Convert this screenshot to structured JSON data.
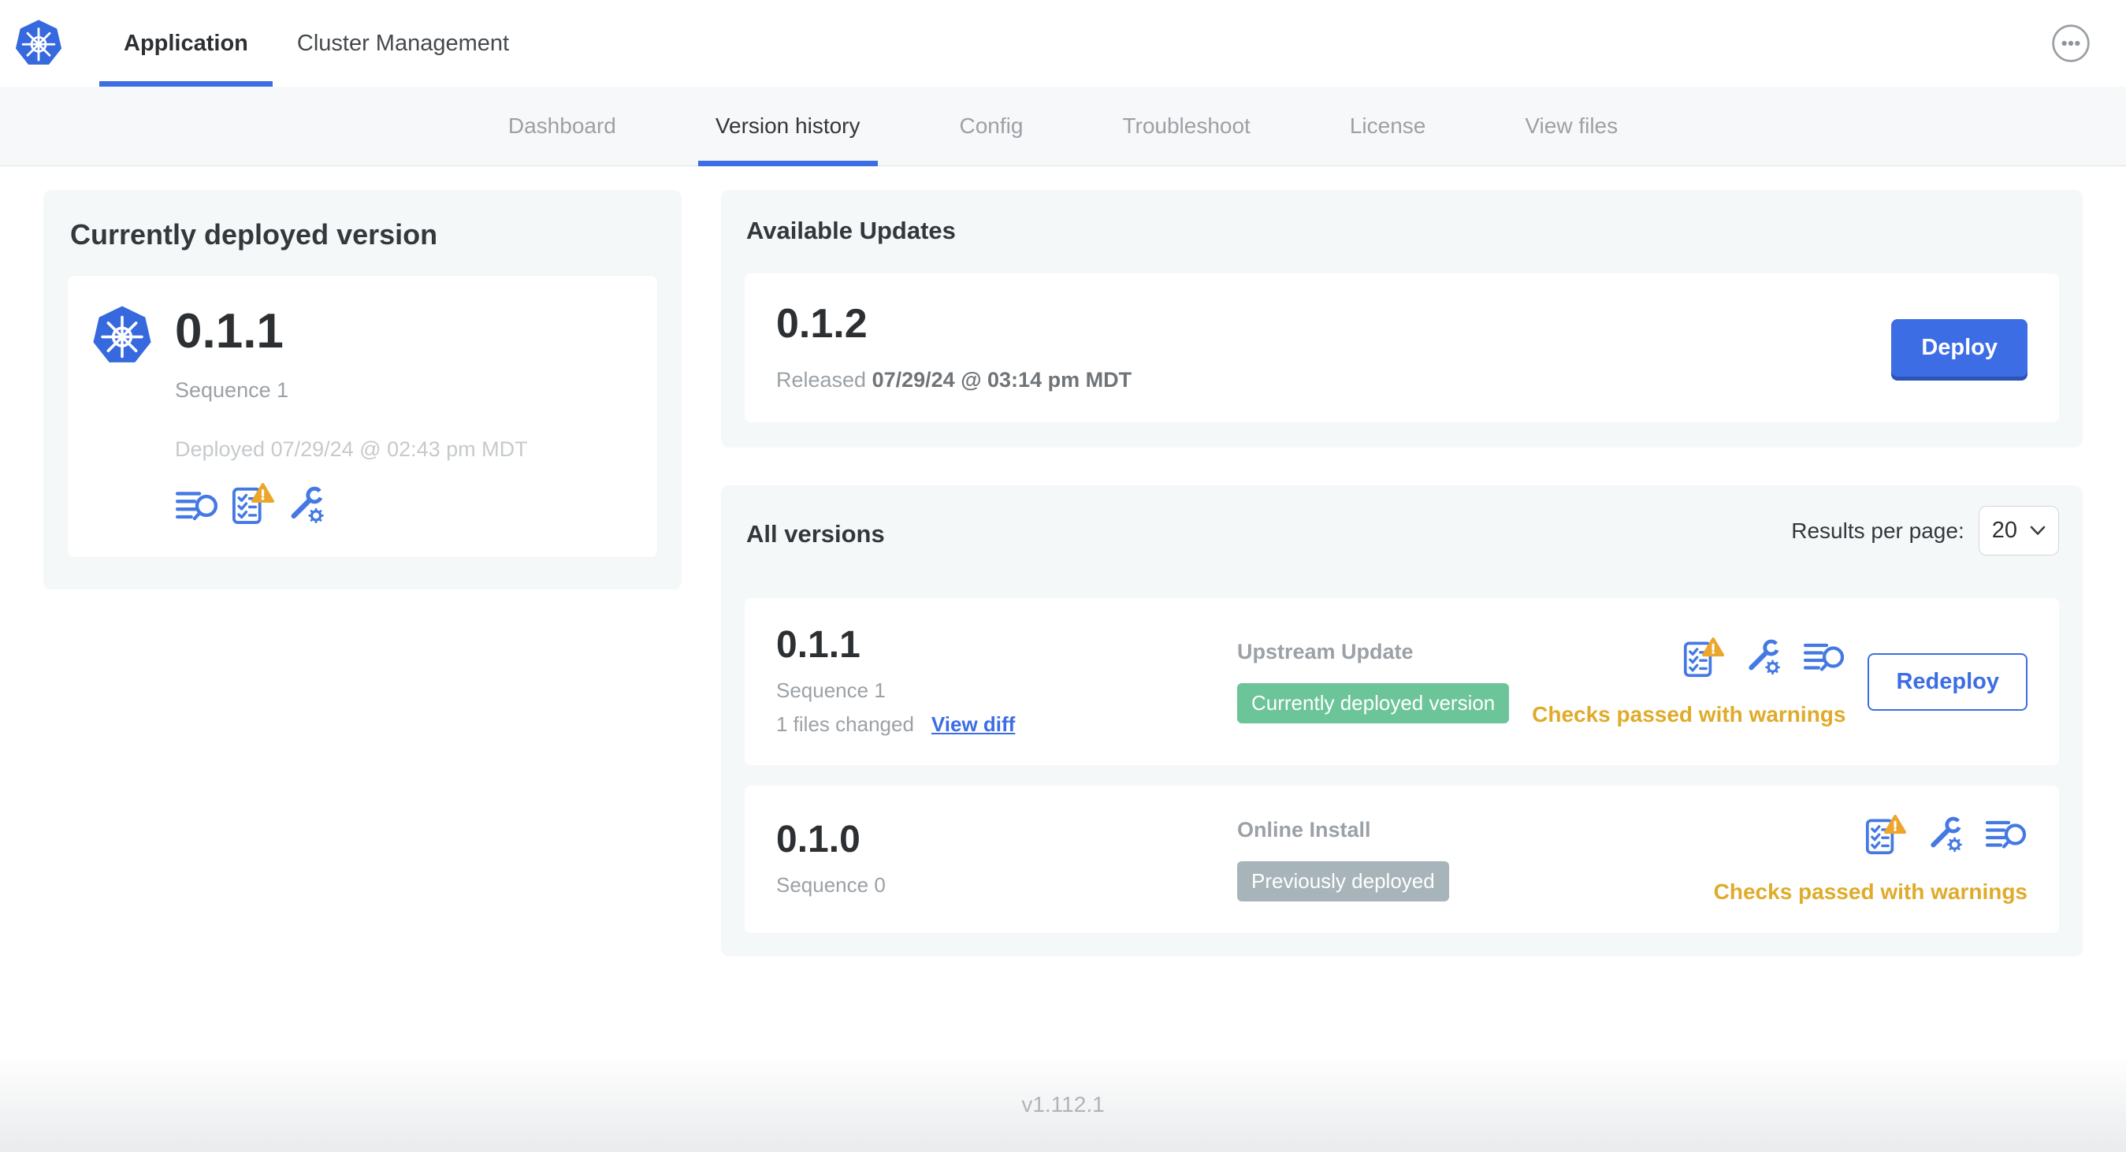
{
  "topbar": {
    "tabs": [
      {
        "label": "Application",
        "active": true
      },
      {
        "label": "Cluster Management",
        "active": false
      }
    ],
    "menu_icon": "ellipsis-icon",
    "logo_icon": "kubernetes-logo"
  },
  "subnav": {
    "items": [
      {
        "label": "Dashboard",
        "active": false
      },
      {
        "label": "Version history",
        "active": true
      },
      {
        "label": "Config",
        "active": false
      },
      {
        "label": "Troubleshoot",
        "active": false
      },
      {
        "label": "License",
        "active": false
      },
      {
        "label": "View files",
        "active": false
      }
    ]
  },
  "current_version": {
    "title": "Currently deployed version",
    "version": "0.1.1",
    "sequence": "Sequence 1",
    "deployed": "Deployed 07/29/24 @ 02:43 pm MDT",
    "icons": [
      "diff-logs-icon",
      "preflight-checks-warning-icon",
      "config-icon"
    ]
  },
  "available_updates": {
    "title": "Available Updates",
    "update": {
      "version": "0.1.2",
      "released_label": "Released",
      "released_date": "07/29/24 @ 03:14 pm MDT",
      "deploy_label": "Deploy"
    }
  },
  "all_versions": {
    "title": "All versions",
    "results_per_page_label": "Results per page:",
    "results_per_page_value": "20",
    "rows": [
      {
        "version": "0.1.1",
        "sequence": "Sequence 1",
        "files_changed": "1 files changed",
        "view_diff_label": "View diff",
        "source": "Upstream Update",
        "badge": "Currently deployed version",
        "badge_style": "green",
        "icons": [
          "preflight-checks-warning-icon",
          "config-icon",
          "diff-logs-icon"
        ],
        "checks_status": "Checks passed with warnings",
        "action_label": "Redeploy"
      },
      {
        "version": "0.1.0",
        "sequence": "Sequence 0",
        "source": "Online Install",
        "badge": "Previously deployed",
        "badge_style": "gray",
        "icons": [
          "preflight-checks-warning-icon",
          "config-icon",
          "diff-logs-icon"
        ],
        "checks_status": "Checks passed with warnings"
      }
    ]
  },
  "footer": {
    "app_version": "v1.112.1"
  },
  "colors": {
    "primary_blue": "#3d6de4",
    "icon_blue": "#4479e4",
    "logo_blue": "#3668de",
    "warning_text": "#dfab2a",
    "warning_triangle": "#eda62c",
    "badge_green": "#6cc499",
    "badge_gray": "#a7b4b9",
    "card_background": "#f5f8f9"
  }
}
